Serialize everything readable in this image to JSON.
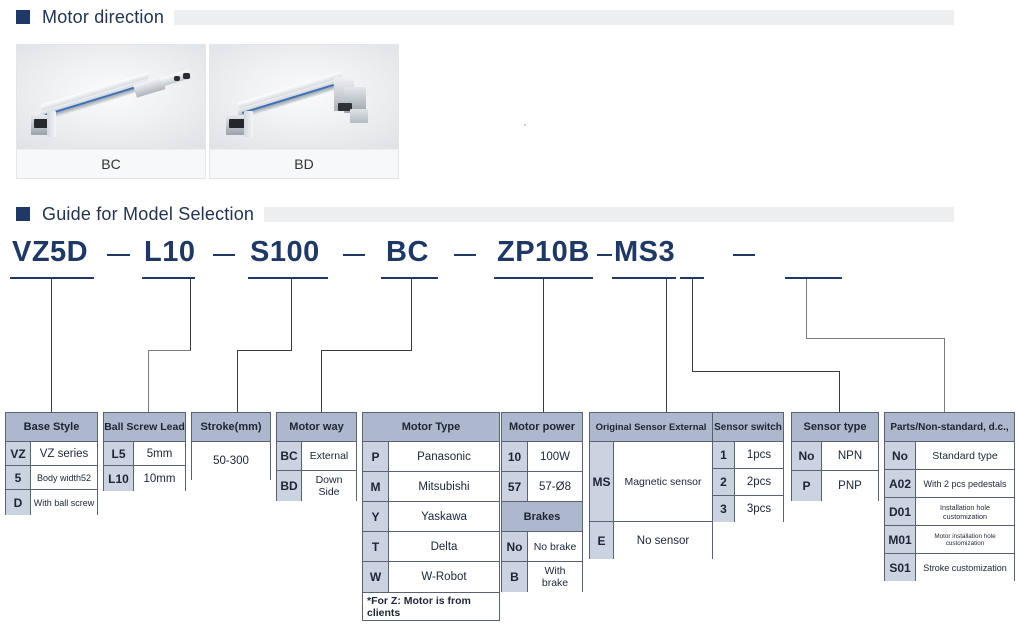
{
  "sections": {
    "motor_direction": {
      "title": "Motor direction"
    },
    "model_guide": {
      "title": "Guide  for  Model  Selection"
    }
  },
  "motor_direction": {
    "cards": [
      {
        "caption": "BC"
      },
      {
        "caption": "BD"
      }
    ]
  },
  "model_code": {
    "parts": [
      "VZ5D",
      "L10",
      "S100",
      "BC",
      "ZP10B",
      "MS3",
      "",
      ""
    ],
    "separator": "—"
  },
  "tables": {
    "base_style": {
      "header": "Base Style",
      "rows": [
        {
          "code": "VZ",
          "desc": "VZ series"
        },
        {
          "code": "5",
          "desc": "Body width52"
        },
        {
          "code": "D",
          "desc": "With ball screw"
        }
      ]
    },
    "ball_screw_lead": {
      "header": "Ball Screw Lead",
      "rows": [
        {
          "code": "L5",
          "desc": "5mm"
        },
        {
          "code": "L10",
          "desc": "10mm"
        }
      ]
    },
    "stroke": {
      "header": "Stroke(mm)",
      "value": "50-300"
    },
    "motor_way": {
      "header": "Motor way",
      "rows": [
        {
          "code": "BC",
          "desc": "External"
        },
        {
          "code": "BD",
          "desc": "Down Side"
        }
      ]
    },
    "motor_type": {
      "header": "Motor Type",
      "rows": [
        {
          "code": "P",
          "desc": "Panasonic"
        },
        {
          "code": "M",
          "desc": "Mitsubishi"
        },
        {
          "code": "Y",
          "desc": "Yaskawa"
        },
        {
          "code": "T",
          "desc": "Delta"
        },
        {
          "code": "W",
          "desc": "W-Robot"
        }
      ],
      "footnote": "*For Z: Motor is from clients"
    },
    "motor_power": {
      "header": "Motor power",
      "rows": [
        {
          "code": "10",
          "desc": "100W"
        },
        {
          "code": "57",
          "desc": "57-Ø8"
        }
      ],
      "brakes_header": "Brakes",
      "brakes_rows": [
        {
          "code": "No",
          "desc": "No brake"
        },
        {
          "code": "B",
          "desc": "With brake"
        }
      ]
    },
    "original_sensor": {
      "header": "Original Sensor External",
      "rows": [
        {
          "code": "MS",
          "desc": "Magnetic sensor"
        },
        {
          "code": "E",
          "desc": "No sensor"
        }
      ]
    },
    "sensor_switch": {
      "header": "Sensor switch",
      "rows": [
        {
          "code": "1",
          "desc": "1pcs"
        },
        {
          "code": "2",
          "desc": "2pcs"
        },
        {
          "code": "3",
          "desc": "3pcs"
        }
      ]
    },
    "sensor_type": {
      "header": "Sensor type",
      "rows": [
        {
          "code": "No",
          "desc": "NPN"
        },
        {
          "code": "P",
          "desc": "PNP"
        }
      ]
    },
    "parts_nonstandard": {
      "header": "Parts/Non-standard, d.c.,",
      "rows": [
        {
          "code": "No",
          "desc": "Standard type"
        },
        {
          "code": "A02",
          "desc": "With 2 pcs pedestals"
        },
        {
          "code": "D01",
          "desc": "Installation hole customization"
        },
        {
          "code": "M01",
          "desc": "Motor installation hole customization"
        },
        {
          "code": "S01",
          "desc": "Stroke customization"
        }
      ]
    }
  },
  "colors": {
    "header_navy": "#1f3864",
    "table_header": "#aeb8cc",
    "code_cell": "#ccd3e0",
    "border": "#5a6173"
  }
}
